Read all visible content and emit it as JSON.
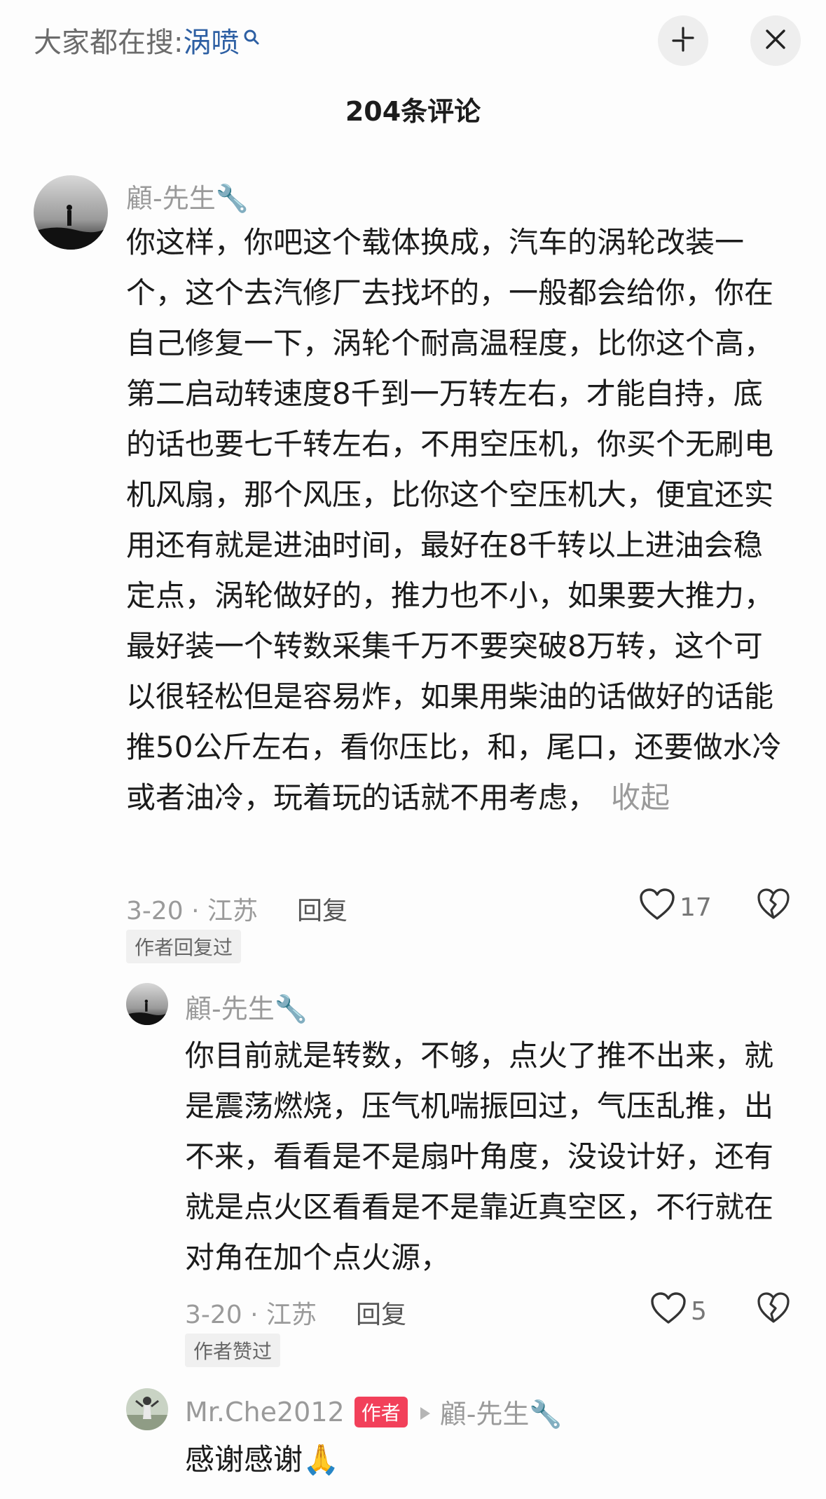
{
  "header": {
    "hot_search_prefix": "大家都在搜:",
    "hot_search_keyword": "涡喷",
    "icons": {
      "search": "search-icon",
      "collapse": "collapse-icon",
      "close": "close-icon"
    }
  },
  "comments_count_title": "204条评论",
  "comment1": {
    "username": "顧-先生🔧",
    "text": "你这样，你吧这个载体换成，汽车的涡轮改装一个，这个去汽修厂去找坏的，一般都会给你，你在自己修复一下，涡轮个耐高温程度，比你这个高，第二启动转速度8千到一万转左右，才能自持，底的话也要七千转左右，不用空压机，你买个无刷电机风扇，那个风压，比你这个空压机大，便宜还实用还有就是进油时间，最好在8千转以上进油会稳定点，涡轮做好的，推力也不小，如果要大推力，最好装一个转数采集千万不要突破8万转，这个可以很轻松但是容易炸，如果用柴油的话做好的话能推50公斤左右，看你压比，和，尾口，还要做水冷或者油冷，玩着玩的话就不用考虑，",
    "collapse_label": "收起",
    "meta": "3-20 · 江苏",
    "reply_label": "回复",
    "likes": "17",
    "tag": "作者回复过"
  },
  "reply1": {
    "username": "顧-先生🔧",
    "text": "你目前就是转数，不够，点火了推不出来，就是震荡燃烧，压气机喘振回过，气压乱推，出不来，看看是不是扇叶角度，没设计好，还有就是点火区看看是不是靠近真空区，不行就在对角在加个点火源，",
    "meta": "3-20 · 江苏",
    "reply_label": "回复",
    "likes": "5",
    "tag": "作者赞过"
  },
  "reply2": {
    "username": "Mr.Che2012",
    "badge": "作者",
    "reply_to": "顧-先生🔧",
    "text": "感谢感谢🙏"
  },
  "colors": {
    "keyword": "#2d5fa3",
    "badge": "#f2405a",
    "meta": "#9a9a9a"
  }
}
